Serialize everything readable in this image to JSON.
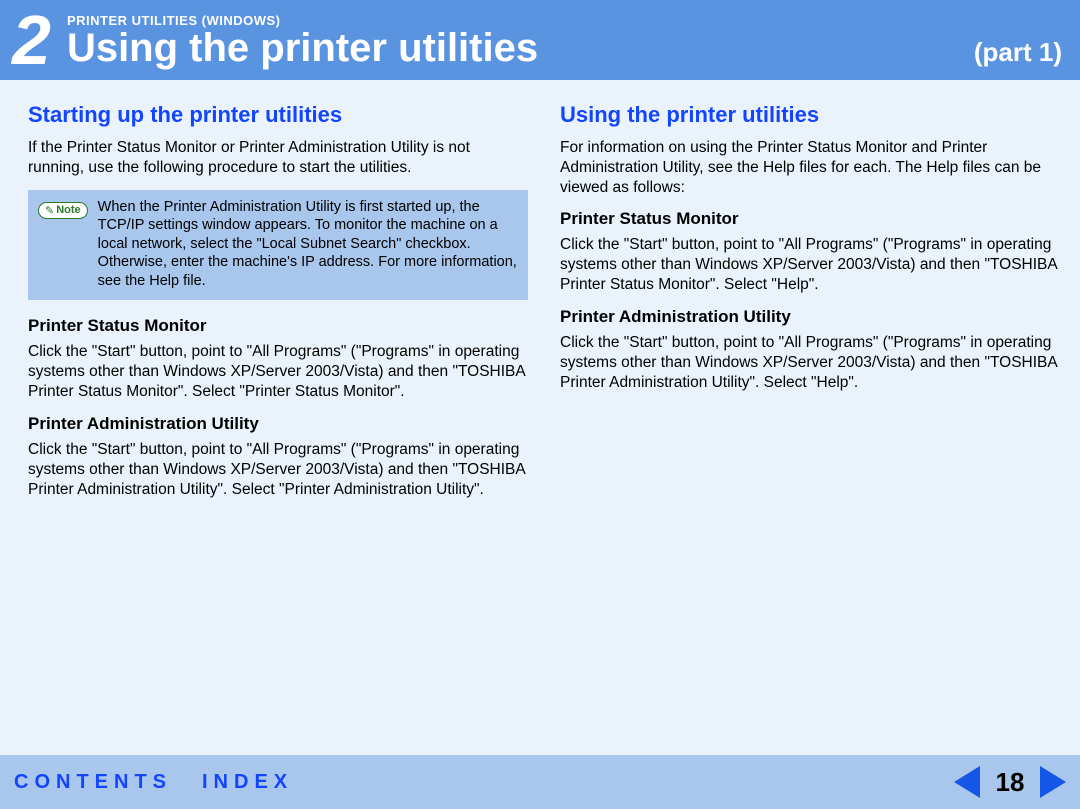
{
  "header": {
    "chapter_number": "2",
    "eyebrow": "PRINTER UTILITIES (WINDOWS)",
    "title": "Using the printer utilities",
    "part": "(part 1)"
  },
  "left": {
    "heading": "Starting up the printer utilities",
    "intro": "If the Printer Status Monitor or Printer Administration Utility is not running, use the following procedure to start the utilities.",
    "note_label": "Note",
    "note_body": "When the Printer Administration Utility is first started up, the TCP/IP settings window appears. To monitor the machine on a local network, select the \"Local Subnet Search\" checkbox. Otherwise, enter the machine's IP address. For more information, see the Help file.",
    "sec1_title": "Printer Status Monitor",
    "sec1_body": "Click the \"Start\" button, point to \"All Programs\" (\"Programs\" in operating systems other than Windows XP/Server 2003/Vista) and then \"TOSHIBA Printer Status Monitor\". Select \"Printer Status Monitor\".",
    "sec2_title": "Printer Administration Utility",
    "sec2_body": "Click the \"Start\" button, point to \"All Programs\" (\"Programs\" in operating systems other than Windows XP/Server 2003/Vista) and then \"TOSHIBA Printer Administration Utility\". Select \"Printer Administration Utility\"."
  },
  "right": {
    "heading": "Using the printer utilities",
    "intro": "For information on using the Printer Status Monitor and Printer Administration Utility, see the Help files for each. The Help files can be viewed as follows:",
    "sec1_title": "Printer Status Monitor",
    "sec1_body": "Click the \"Start\" button, point to \"All Programs\" (\"Programs\" in operating systems other than Windows XP/Server 2003/Vista) and then \"TOSHIBA Printer Status Monitor\". Select \"Help\".",
    "sec2_title": "Printer Administration Utility",
    "sec2_body": "Click the \"Start\" button, point to \"All Programs\" (\"Programs\" in operating systems other than Windows XP/Server 2003/Vista) and then \"TOSHIBA Printer Administration Utility\". Select \"Help\"."
  },
  "footer": {
    "contents": "CONTENTS",
    "index": "INDEX",
    "page": "18"
  }
}
